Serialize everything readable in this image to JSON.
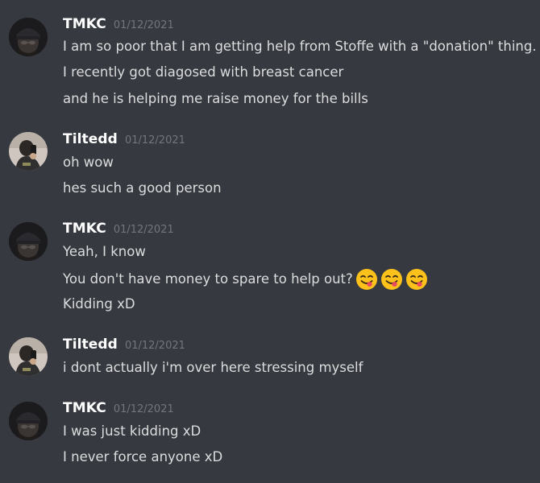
{
  "messages": [
    {
      "username": "TMKC",
      "timestamp": "01/12/2021",
      "avatar": "beanie-avatar-icon",
      "lines": [
        "I am so poor that I am getting help from Stoffe with a \"donation\" thing.",
        "I recently got diagosed with breast cancer",
        "and he is helping me raise money for the bills"
      ]
    },
    {
      "username": "Tiltedd",
      "timestamp": "01/12/2021",
      "avatar": "selfie-avatar-icon",
      "lines": [
        "oh wow",
        "hes such a good person"
      ]
    },
    {
      "username": "TMKC",
      "timestamp": "01/12/2021",
      "avatar": "beanie-avatar-icon",
      "lines": [
        "Yeah, I know",
        "You don't have money to spare to help out?",
        "Kidding xD"
      ],
      "emojis": [
        "yum-face-emoji",
        "yum-face-emoji",
        "yum-face-emoji"
      ]
    },
    {
      "username": "Tiltedd",
      "timestamp": "01/12/2021",
      "avatar": "selfie-avatar-icon",
      "lines": [
        "i dont actually i'm over here stressing myself"
      ]
    },
    {
      "username": "TMKC",
      "timestamp": "01/12/2021",
      "avatar": "beanie-avatar-icon",
      "lines": [
        "I was just kidding xD",
        "I never force anyone xD"
      ]
    }
  ],
  "colors": {
    "background": "#36393f",
    "username": "#ffffff",
    "timestamp": "#72767d",
    "text": "#dcddde",
    "emoji_face": "#fcc21b",
    "emoji_tongue": "#e84a5f"
  }
}
